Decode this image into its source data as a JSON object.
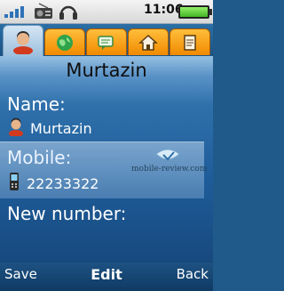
{
  "status_bar": {
    "time": "11:06",
    "icons": [
      "signal-bars-icon",
      "radio-icon",
      "headset-icon",
      "battery-icon"
    ]
  },
  "tabs": [
    {
      "icon": "contact-person-icon",
      "active": true
    },
    {
      "icon": "globe-icon",
      "active": false
    },
    {
      "icon": "chat-bubble-icon",
      "active": false
    },
    {
      "icon": "home-icon",
      "active": false
    },
    {
      "icon": "note-icon",
      "active": false
    }
  ],
  "contact": {
    "title": "Murtazin",
    "name_label": "Name:",
    "name_value": "Murtazin",
    "mobile_label": "Mobile:",
    "mobile_value": "22233322",
    "new_number_label": "New number:"
  },
  "watermark": {
    "text": "mobile-review.com"
  },
  "softkeys": {
    "left": "Save",
    "center": "Edit",
    "right": "Back"
  },
  "colors": {
    "tab_orange": "#f08a00",
    "background_blue": "#1f5a8a",
    "battery_green": "#41b524"
  }
}
